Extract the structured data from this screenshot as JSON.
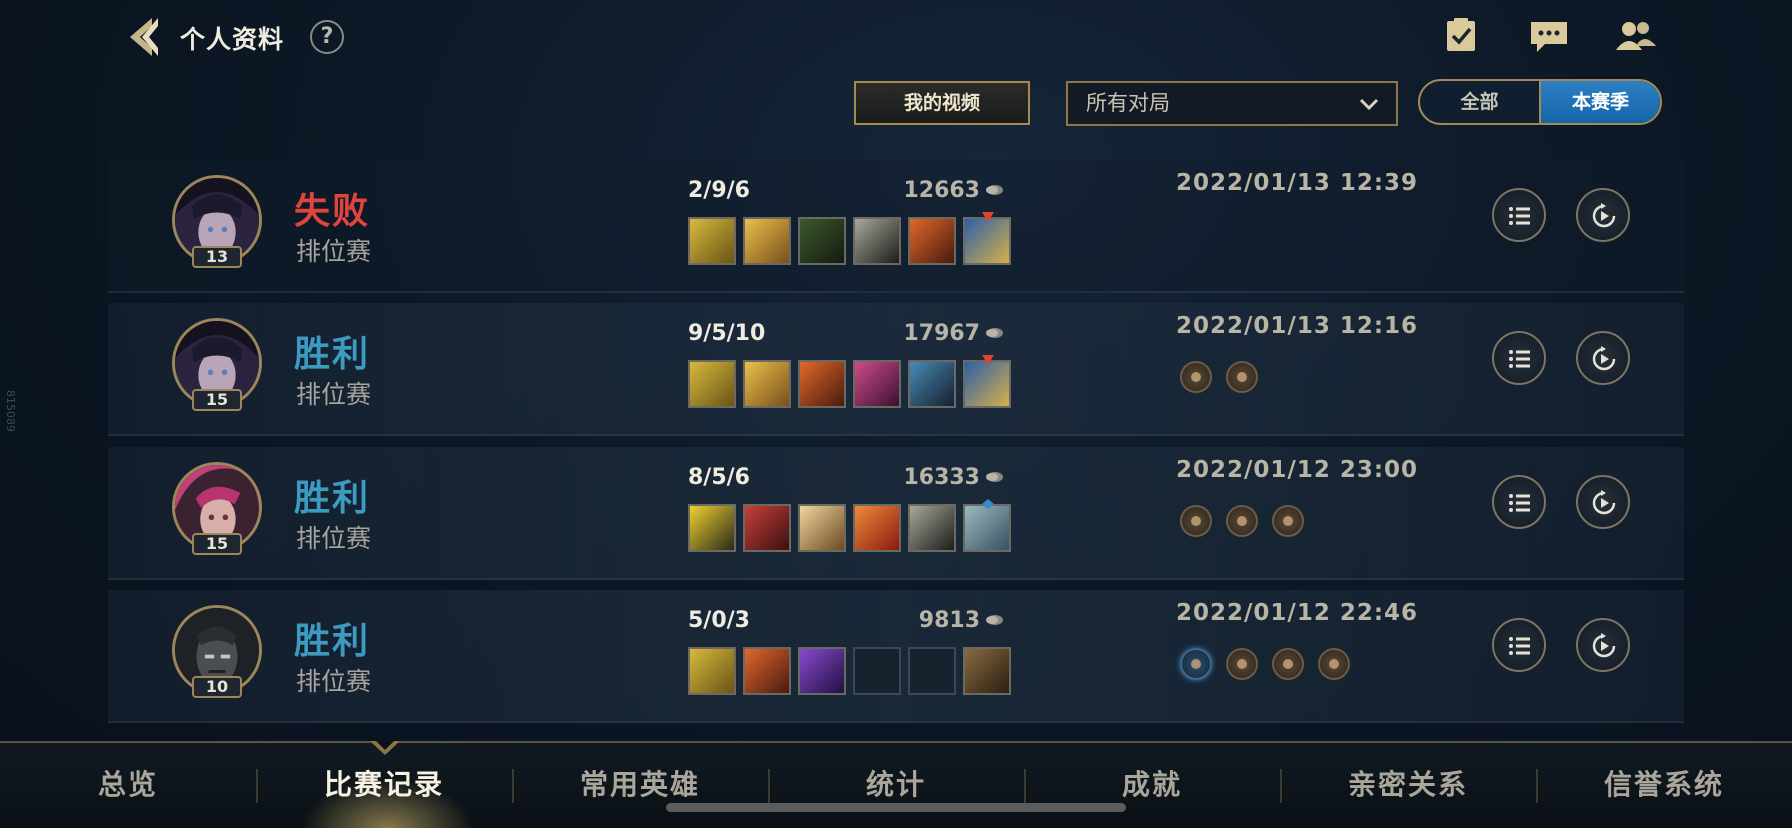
{
  "header": {
    "title": "个人资料",
    "help_glyph": "?",
    "icons": [
      "back-arrow-icon",
      "clipboard-check-icon",
      "chat-bubble-icon",
      "friends-icon"
    ]
  },
  "controls": {
    "video_button": "我的视频",
    "match_filter": "所有对局",
    "season_toggle": {
      "options": [
        "全部",
        "本赛季"
      ],
      "active": "本赛季"
    }
  },
  "matches": [
    {
      "result": "失败",
      "outcome": "loss",
      "mode": "排位赛",
      "level": "13",
      "kda": "2/9/6",
      "gold": "12663",
      "date": "2022/01/13 12:39",
      "badges": 0
    },
    {
      "result": "胜利",
      "outcome": "win",
      "mode": "排位赛",
      "level": "15",
      "kda": "9/5/10",
      "gold": "17967",
      "date": "2022/01/13 12:16",
      "badges": 2
    },
    {
      "result": "胜利",
      "outcome": "win",
      "mode": "排位赛",
      "level": "15",
      "kda": "8/5/6",
      "gold": "16333",
      "date": "2022/01/12 23:00",
      "badges": 3
    },
    {
      "result": "胜利",
      "outcome": "win",
      "mode": "排位赛",
      "level": "10",
      "kda": "5/0/3",
      "gold": "9813",
      "date": "2022/01/12 22:46",
      "badges": 4
    }
  ],
  "tabs": [
    "总览",
    "比赛记录",
    "常用英雄",
    "统计",
    "成就",
    "亲密关系",
    "信誉系统"
  ],
  "active_tab": "比赛记录",
  "side_watermark": "815089",
  "colors": {
    "loss": "#e0443e",
    "win": "#3d9ac0",
    "accent_gold": "#a8894e",
    "toggle_active": "#1f73b8"
  }
}
